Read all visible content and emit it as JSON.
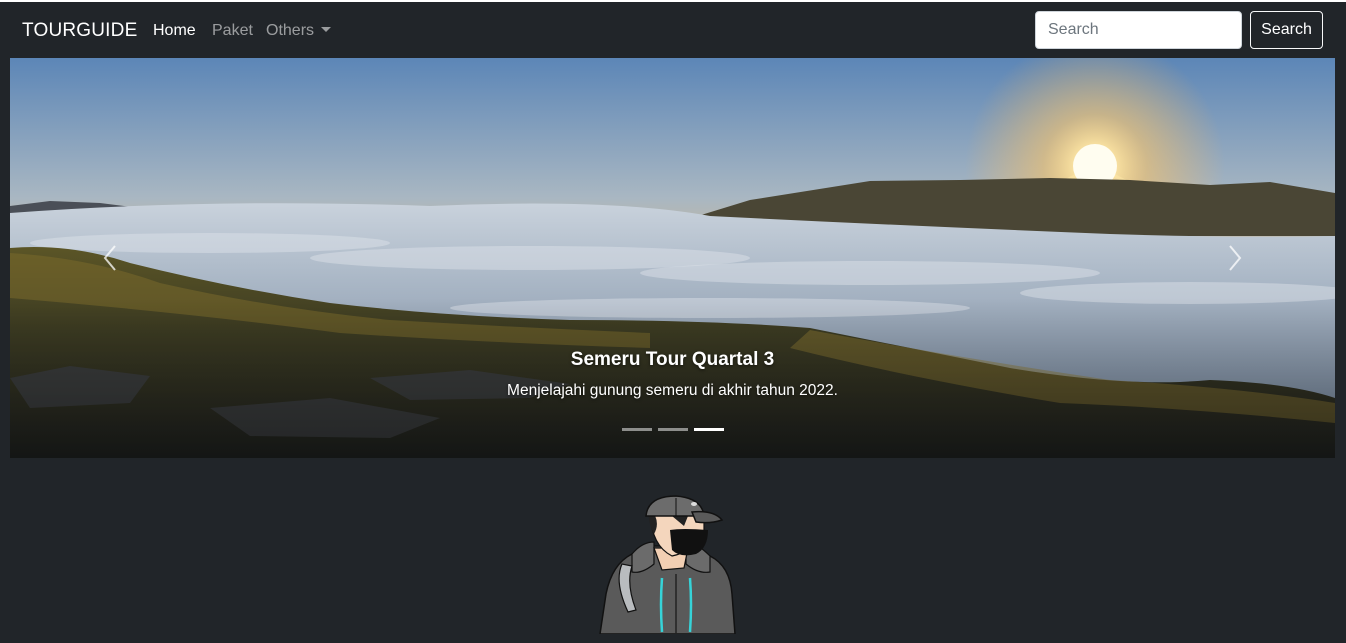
{
  "navbar": {
    "brand": "TOURGUIDE",
    "links": [
      {
        "label": "Home",
        "active": true
      },
      {
        "label": "Paket",
        "active": false
      },
      {
        "label": "Others",
        "active": false,
        "dropdown": true
      }
    ],
    "search": {
      "placeholder": "Search",
      "value": ""
    },
    "search_button": "Search"
  },
  "carousel": {
    "slide": {
      "title": "Semeru Tour Quartal 3",
      "text": "Menjelajahi gunung semeru di akhir tahun 2022."
    },
    "indicators": 3,
    "active_indicator": 3,
    "controls": {
      "prev_icon": "chevron-left-icon",
      "next_icon": "chevron-right-icon"
    }
  },
  "avatar": {
    "image": "masked-hooded-traveler-illustration"
  },
  "colors": {
    "background": "#212529",
    "nav_text_muted": "rgba(255,255,255,0.55)",
    "white": "#ffffff"
  }
}
